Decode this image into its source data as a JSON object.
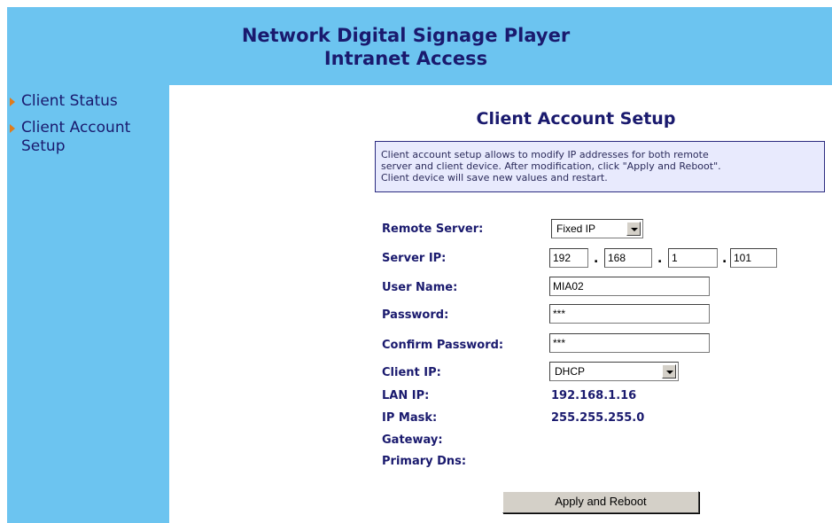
{
  "header": {
    "title_line1": "Network Digital Signage Player",
    "title_line2": "Intranet Access"
  },
  "sidebar": {
    "items": [
      {
        "label": "Client Status"
      },
      {
        "label_line1": "Client Account",
        "label_line2": "Setup"
      }
    ]
  },
  "main": {
    "title": "Client Account Setup",
    "info_line1": "Client account setup allows to modify IP addresses for both remote",
    "info_line2": "server and client device. After modification, click \"Apply and Reboot\".",
    "info_line3": "Client device will save new values and restart.",
    "form": {
      "remote_server": {
        "label": "Remote Server:",
        "value": "Fixed IP"
      },
      "server_ip": {
        "label": "Server IP:",
        "oct1": "192",
        "oct2": "168",
        "oct3": "1",
        "oct4": "101"
      },
      "user_name": {
        "label": "User Name:",
        "value": "MIA02"
      },
      "password": {
        "label": "Password:",
        "value": "***"
      },
      "confirm_password": {
        "label": "Confirm Password:",
        "value": "***"
      },
      "client_ip": {
        "label": "Client IP:",
        "value": "DHCP"
      },
      "lan_ip": {
        "label": "LAN IP:",
        "value": "192.168.1.16"
      },
      "ip_mask": {
        "label": "IP Mask:",
        "value": "255.255.255.0"
      },
      "gateway": {
        "label": "Gateway:",
        "value": ""
      },
      "primary_dns": {
        "label": "Primary Dns:",
        "value": ""
      }
    },
    "apply_button": "Apply and Reboot"
  },
  "colors": {
    "panel_blue": "#6cc4f0",
    "text_navy": "#1a1a6e",
    "nav_arrow": "#e07b1a",
    "info_bg": "#e8eafd"
  },
  "icons": {
    "nav_bullet": "triangle-right-icon",
    "dropdown": "chevron-down-icon"
  }
}
